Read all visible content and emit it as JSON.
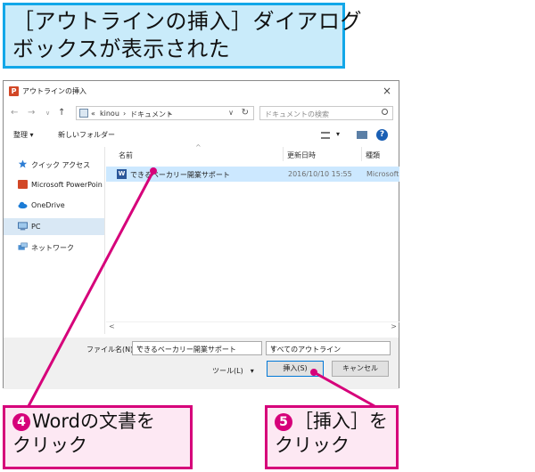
{
  "banner": {
    "line1": "［アウトラインの挿入］ダイアログ",
    "line2": "ボックスが表示された"
  },
  "dialog": {
    "title": "アウトラインの挿入",
    "close": "×",
    "address": {
      "back": "←",
      "forward": "→",
      "dropdown": "∨",
      "up": "↑",
      "sep": "«",
      "crumbs": [
        "kinou",
        "›",
        "ドキュメント",
        "›"
      ],
      "path_dropdown": "∨",
      "refresh": "↻",
      "search_placeholder": "ドキュメントの検索"
    },
    "toolbar": {
      "organize": "整理 ▾",
      "new_folder": "新しいフォルダー",
      "view_dd": "▾"
    },
    "help": "?",
    "nav_items": [
      {
        "label": "クイック アクセス",
        "icon": "star-icon"
      },
      {
        "label": "Microsoft PowerPoin",
        "icon": "powerpoint-icon"
      },
      {
        "label": "OneDrive",
        "icon": "cloud-icon"
      },
      {
        "label": "PC",
        "icon": "computer-icon"
      },
      {
        "label": "ネットワーク",
        "icon": "network-icon"
      }
    ],
    "columns": [
      "名前",
      "更新日時",
      "種類"
    ],
    "sort_indicator": "^",
    "files": [
      {
        "name": "できるベーカリー開業サポート",
        "modified": "2016/10/10 15:55",
        "type": "Microsoft"
      }
    ],
    "file_icon_letter": "W",
    "scroll_left": "<",
    "scroll_right": ">",
    "filename_label": "ファイル名(N):",
    "filename_value": "できるベーカリー開業サポート",
    "filetype_value": "すべてのアウトライン",
    "combo_dd": "∨",
    "tools_label": "ツール(L)　▾",
    "insert_label": "挿入(S)",
    "cancel_label": "キャンセル"
  },
  "callouts": {
    "step4_num": "4",
    "step4_line1": "Wordの文書を",
    "step4_line2": "クリック",
    "step5_num": "5",
    "step5_line1": "［挿入］を",
    "step5_line2": "クリック"
  },
  "colors": {
    "banner_bg": "#c9ebfa",
    "banner_border": "#12a7e8",
    "callout_bg": "#fde8f3",
    "callout_border": "#d6007a",
    "selection": "#cce8ff"
  }
}
